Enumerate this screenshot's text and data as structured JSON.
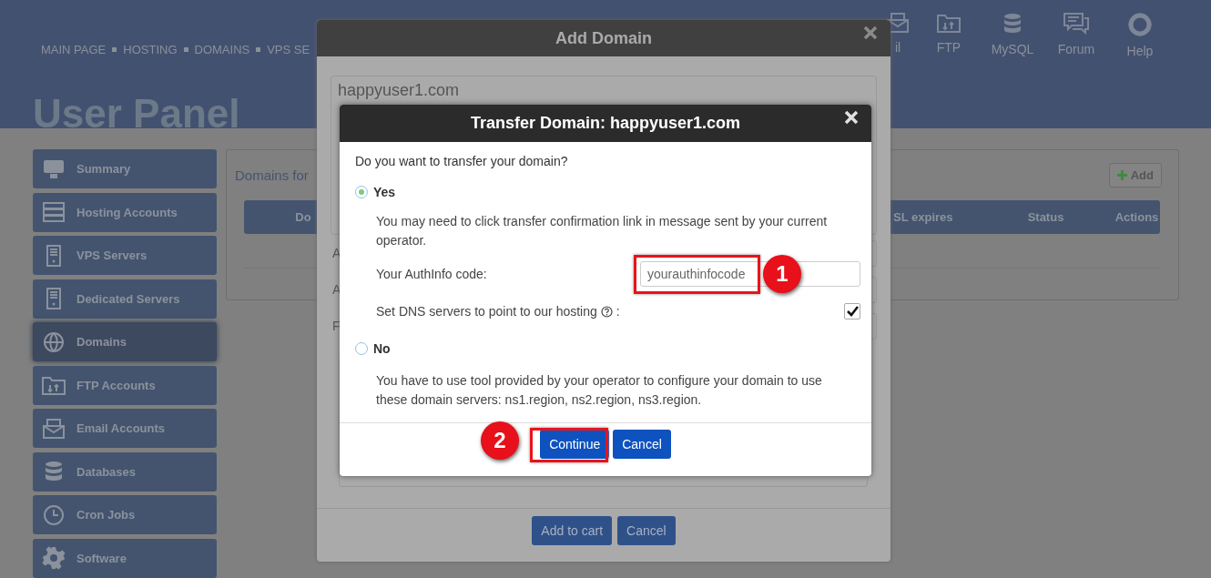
{
  "header": {
    "nav": [
      "MAIN PAGE",
      "HOSTING",
      "DOMAINS",
      "VPS SE"
    ],
    "title": "User Panel",
    "shortcuts": [
      {
        "label": "il",
        "kind": "mail"
      },
      {
        "label": "FTP",
        "kind": "ftp"
      },
      {
        "label": "MySQL",
        "kind": "database"
      },
      {
        "label": "Forum",
        "kind": "forum"
      },
      {
        "label": "Help",
        "kind": "help"
      }
    ]
  },
  "sidebar": {
    "items": [
      {
        "label": "Summary",
        "kind": "monitor",
        "selected": false
      },
      {
        "label": "Hosting Accounts",
        "kind": "server-rack",
        "selected": false
      },
      {
        "label": "VPS Servers",
        "kind": "tower",
        "selected": false
      },
      {
        "label": "Dedicated Servers",
        "kind": "tower",
        "selected": false
      },
      {
        "label": "Domains",
        "kind": "globe",
        "selected": true
      },
      {
        "label": "FTP Accounts",
        "kind": "ftp",
        "selected": false
      },
      {
        "label": "Email Accounts",
        "kind": "mail",
        "selected": false
      },
      {
        "label": "Databases",
        "kind": "database",
        "selected": false
      },
      {
        "label": "Cron Jobs",
        "kind": "clock",
        "selected": false
      },
      {
        "label": "Software",
        "kind": "gear",
        "selected": false
      }
    ]
  },
  "domains_panel": {
    "title": "Domains for",
    "add_button": "Add",
    "columns": [
      "Do",
      "SL expires",
      "Status",
      "Actions"
    ]
  },
  "add_domain_dialog": {
    "title": "Add Domain",
    "domain": "happyuser1.com",
    "field_labels": [
      "A",
      "A",
      "F"
    ],
    "buttons": [
      "Add to cart",
      "Cancel"
    ]
  },
  "transfer_dialog": {
    "title": "Transfer Domain: happyuser1.com",
    "question": "Do you want to transfer your domain?",
    "yes": {
      "label": "Yes",
      "selected": true,
      "description": "You may need to click transfer confirmation link in message sent by your current operator.",
      "authinfo_label": "Your AuthInfo code:",
      "authinfo_placeholder": "yourauthinfocode",
      "dns_label": "Set DNS servers to point to our hosting",
      "dns_suffix": ":",
      "dns_checked": true
    },
    "no": {
      "label": "No",
      "selected": false,
      "description": "You have to use tool provided by your operator to configure your domain to use these domain servers: ns1.region, ns2.region, ns3.region."
    },
    "buttons": [
      "Continue",
      "Cancel"
    ]
  },
  "callouts": [
    "1",
    "2"
  ]
}
